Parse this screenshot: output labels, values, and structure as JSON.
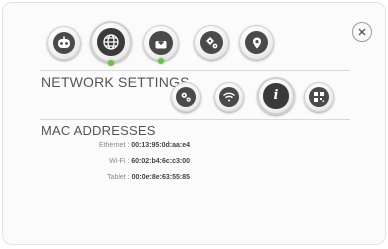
{
  "top_nav": {
    "items": [
      {
        "name": "robot",
        "active": false,
        "online": false
      },
      {
        "name": "network",
        "active": true,
        "online": true
      },
      {
        "name": "download",
        "active": false,
        "online": true
      },
      {
        "name": "settings",
        "active": false,
        "online": false
      },
      {
        "name": "location",
        "active": false,
        "online": false
      }
    ]
  },
  "network": {
    "title": "NETWORK SETTINGS",
    "tabs": [
      {
        "name": "settings",
        "active": false
      },
      {
        "name": "wifi",
        "active": false
      },
      {
        "name": "info",
        "active": true
      },
      {
        "name": "qr-code",
        "active": false
      }
    ]
  },
  "mac": {
    "title": "MAC ADDRESSES",
    "rows": [
      {
        "label": "Ethernet",
        "value": "00:13:95:0d:aa:e4"
      },
      {
        "label": "Wi-Fi",
        "value": "60:02:b4:6c:c3:00"
      },
      {
        "label": "Tablet",
        "value": "00:0e:8e:63:55:85"
      }
    ]
  },
  "colors": {
    "online_dot": "#6ac04a",
    "icon_dark": "#4a4a4a",
    "text_title": "#555555"
  }
}
